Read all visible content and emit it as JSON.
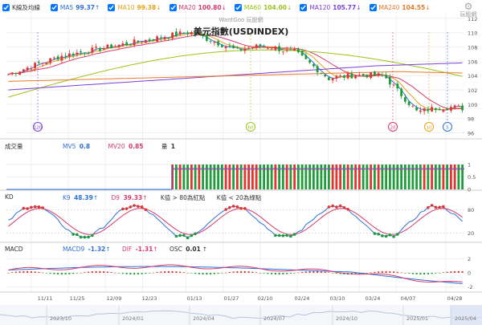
{
  "toolbar": {
    "main_label": "K線及均線",
    "ma5": {
      "label": "MA5",
      "value": "99.37",
      "arrow": "↑",
      "color": "#2f6fd8"
    },
    "ma10": {
      "label": "MA10",
      "value": "99.38",
      "arrow": "↓",
      "color": "#e6a21a"
    },
    "ma20": {
      "label": "MA20",
      "value": "100.80",
      "arrow": "↓",
      "color": "#d63a6a"
    },
    "ma60": {
      "label": "MA60",
      "value": "104.00",
      "arrow": "↓",
      "color": "#9ac21a"
    },
    "ma120": {
      "label": "MA120",
      "value": "105.77",
      "arrow": "↓",
      "color": "#7b3fd6"
    },
    "ma240": {
      "label": "MA240",
      "value": "104.55",
      "arrow": "↓",
      "color": "#e8792b"
    }
  },
  "logo_text": "玩股網",
  "watermark": "WantGoo 玩股網",
  "chart_title": "美元指數(USDINDEX)",
  "price_axis": [
    "112",
    "110",
    "108",
    "106",
    "104",
    "102",
    "100",
    "98",
    "96"
  ],
  "period_markers": [
    {
      "label": "120",
      "color": "#7b3fd6"
    },
    {
      "label": "60",
      "color": "#9ac21a"
    },
    {
      "label": "20",
      "color": "#d63a6a"
    },
    {
      "label": "10",
      "color": "#e6a21a"
    },
    {
      "label": "5",
      "color": "#2f6fd8"
    }
  ],
  "volume": {
    "title": "成交量",
    "mv5_label": "MV5",
    "mv5_value": "0.8",
    "mv20_label": "MV20",
    "mv20_value": "0.85",
    "qty_label": "量",
    "qty_value": "1",
    "axis": [
      "1",
      "0.5",
      "0"
    ]
  },
  "kd": {
    "title": "KD",
    "k9_label": "K9",
    "k9_value": "48.39",
    "k9_arrow": "↑",
    "d9_label": "D9",
    "d9_value": "39.33",
    "d9_arrow": "↑",
    "note_red": "K值 > 80為紅點",
    "note_green": "K值 < 20為綠點",
    "axis": [
      "80",
      "20"
    ]
  },
  "macd": {
    "title": "MACD",
    "macd9_label": "MACD9",
    "macd9_value": "-1.32",
    "macd9_arrow": "↑",
    "dif_label": "DIF",
    "dif_value": "-1.31",
    "dif_arrow": "↑",
    "osc_label": "OSC",
    "osc_value": "0.01",
    "osc_arrow": "↑",
    "axis": [
      "2",
      "0",
      "-2"
    ]
  },
  "date_labels": [
    "11/11",
    "11/25",
    "12/09",
    "12/23",
    "01/13",
    "01/27",
    "02/10",
    "02/24",
    "03/10",
    "03/24",
    "04/07",
    "04/28"
  ],
  "range_labels": [
    "2023/10",
    "2024/01",
    "2024/04",
    "2024/07",
    "2024/10",
    "2025/01",
    "2025/04"
  ]
}
